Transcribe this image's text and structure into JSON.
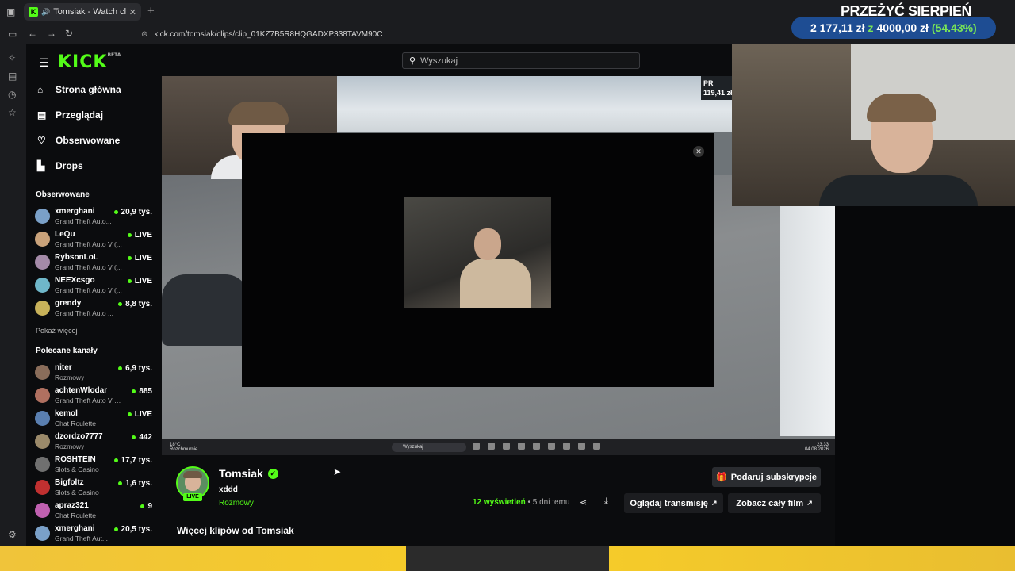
{
  "browser": {
    "tab_title": "Tomsiak - Watch clips on K",
    "tab_favicon": "K",
    "url": "kick.com/tomsiak/clips/clip_01KZ7B5R8HQGADXP338TAVM90C"
  },
  "overlay": {
    "goal_title": "PRZEŻYĆ SIERPIEŃ",
    "current": "2 177,11 zł",
    "sep": "z",
    "target": "4000,00 zł",
    "percent": "(54.43%)",
    "progress": 0.5443
  },
  "kick": {
    "logo": "KICK",
    "beta": "BETA",
    "nav": [
      {
        "label": "Strona główna",
        "icon": "home-icon"
      },
      {
        "label": "Przeglądaj",
        "icon": "browse-icon"
      },
      {
        "label": "Obserwowane",
        "icon": "heart-icon"
      },
      {
        "label": "Drops",
        "icon": "drops-icon"
      }
    ],
    "followed_title": "Obserwowane",
    "followed": [
      {
        "name": "xmerghani",
        "category": "Grand Theft Auto...",
        "viewers": "20,9 tys.",
        "color": "#7aa0c8"
      },
      {
        "name": "LeQu",
        "category": "Grand Theft Auto V (...",
        "viewers": "LIVE",
        "color": "#c9a27a"
      },
      {
        "name": "RybsonLoL",
        "category": "Grand Theft Auto V (...",
        "viewers": "LIVE",
        "color": "#a48aa8"
      },
      {
        "name": "NEEXcsgo",
        "category": "Grand Theft Auto V (...",
        "viewers": "LIVE",
        "color": "#6fb7c9"
      },
      {
        "name": "grendy",
        "category": "Grand Theft Auto ...",
        "viewers": "8,8 tys.",
        "color": "#c8b25a"
      }
    ],
    "show_more": "Pokaż więcej",
    "recommended_title": "Polecane kanały",
    "recommended": [
      {
        "name": "niter",
        "category": "Rozmowy",
        "viewers": "6,9 tys.",
        "color": "#8a6d5a"
      },
      {
        "name": "achtenWlodar",
        "category": "Grand Theft Auto V (G...",
        "viewers": "885",
        "color": "#b07060"
      },
      {
        "name": "kemol",
        "category": "Chat Roulette",
        "viewers": "LIVE",
        "color": "#5a7fb0"
      },
      {
        "name": "dzordzo7777",
        "category": "Rozmowy",
        "viewers": "442",
        "color": "#9b8a6a"
      },
      {
        "name": "ROSHTEIN",
        "category": "Slots & Casino",
        "viewers": "17,7 tys.",
        "color": "#707070"
      },
      {
        "name": "Bigfoltz",
        "category": "Slots & Casino",
        "viewers": "1,6 tys.",
        "color": "#c03030"
      },
      {
        "name": "apraz321",
        "category": "Chat Roulette",
        "viewers": "9",
        "color": "#c060b0"
      },
      {
        "name": "xmerghani",
        "category": "Grand Theft Aut...",
        "viewers": "20,5 tys.",
        "color": "#7aa0c8"
      }
    ],
    "search_placeholder": "Wyszukaj"
  },
  "video": {
    "corner_tag": "PR\n119,41 zł",
    "taskbar_weather": "18°C\nRozchmurnie",
    "taskbar_search": "Wyszukaj",
    "taskbar_time": "23:33\n04.08.2026"
  },
  "clip": {
    "streamer": "Tomsiak",
    "live_badge": "LIVE",
    "title": "xddd",
    "category": "Rozmowy",
    "views_count": "12",
    "views_label": "wyświetleń",
    "age": "• 5 dni temu",
    "gift_button": "Podaruj subskrypcje",
    "watch_stream": "Oglądaj transmisję",
    "watch_full": "Zobacz cały film",
    "more_clips": "Więcej klipów od Tomsiak"
  },
  "colors": {
    "accent": "#53fc18",
    "background": "#0b0c0e",
    "goal_bar": "#1e4d93"
  }
}
